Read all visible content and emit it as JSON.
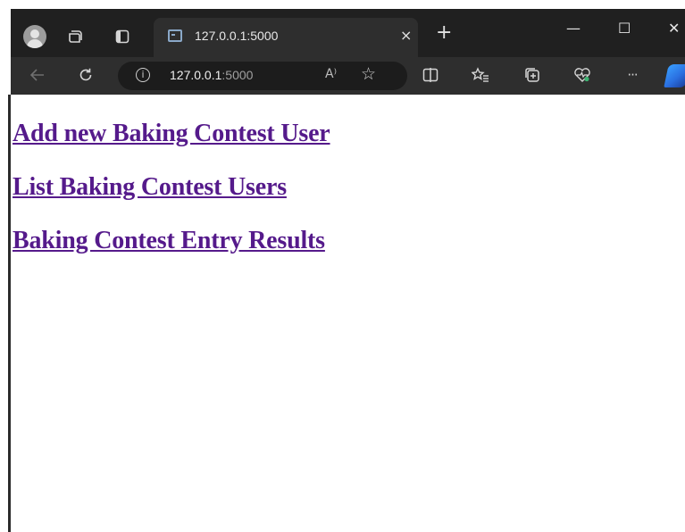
{
  "browser": {
    "tab": {
      "title": "127.0.0.1:5000",
      "close_glyph": "×"
    },
    "new_tab_glyph": "+",
    "window_controls": {
      "minimize": "—",
      "maximize": "☐",
      "close": "✕"
    },
    "address": {
      "host": "127.0.0.1",
      "port": ":5000",
      "read_aloud": "A⁾"
    },
    "toolbar_icons": [
      "back-arrow-icon",
      "refresh-icon",
      "split-screen-icon",
      "favorites-icon",
      "collections-icon",
      "browser-essentials-icon",
      "more-options-icon",
      "copilot-icon"
    ],
    "more_glyph": "···"
  },
  "page": {
    "links": [
      "Add new Baking Contest User",
      "List Baking Contest Users",
      "Baking Contest Entry Results"
    ],
    "link_color": "#551a8b"
  }
}
